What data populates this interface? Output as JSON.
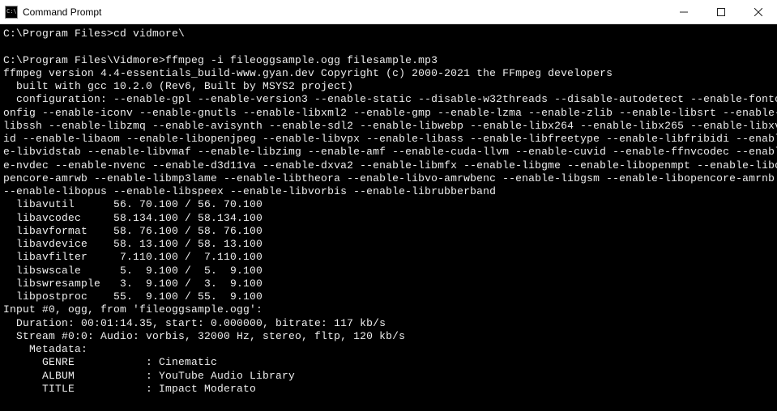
{
  "window": {
    "title": "Command Prompt"
  },
  "terminal": {
    "lines": [
      "C:\\Program Files>cd vidmore\\",
      "",
      "C:\\Program Files\\Vidmore>ffmpeg -i fileoggsample.ogg filesample.mp3",
      "ffmpeg version 4.4-essentials_build-www.gyan.dev Copyright (c) 2000-2021 the FFmpeg developers",
      "  built with gcc 10.2.0 (Rev6, Built by MSYS2 project)",
      "  configuration: --enable-gpl --enable-version3 --enable-static --disable-w32threads --disable-autodetect --enable-fontc",
      "onfig --enable-iconv --enable-gnutls --enable-libxml2 --enable-gmp --enable-lzma --enable-zlib --enable-libsrt --enable-",
      "libssh --enable-libzmq --enable-avisynth --enable-sdl2 --enable-libwebp --enable-libx264 --enable-libx265 --enable-libxv",
      "id --enable-libaom --enable-libopenjpeg --enable-libvpx --enable-libass --enable-libfreetype --enable-libfribidi --enabl",
      "e-libvidstab --enable-libvmaf --enable-libzimg --enable-amf --enable-cuda-llvm --enable-cuvid --enable-ffnvcodec --enabl",
      "e-nvdec --enable-nvenc --enable-d3d11va --enable-dxva2 --enable-libmfx --enable-libgme --enable-libopenmpt --enable-libo",
      "pencore-amrwb --enable-libmp3lame --enable-libtheora --enable-libvo-amrwbenc --enable-libgsm --enable-libopencore-amrnb ",
      "--enable-libopus --enable-libspeex --enable-libvorbis --enable-librubberband",
      "  libavutil      56. 70.100 / 56. 70.100",
      "  libavcodec     58.134.100 / 58.134.100",
      "  libavformat    58. 76.100 / 58. 76.100",
      "  libavdevice    58. 13.100 / 58. 13.100",
      "  libavfilter     7.110.100 /  7.110.100",
      "  libswscale      5.  9.100 /  5.  9.100",
      "  libswresample   3.  9.100 /  3.  9.100",
      "  libpostproc    55.  9.100 / 55.  9.100",
      "Input #0, ogg, from 'fileoggsample.ogg':",
      "  Duration: 00:01:14.35, start: 0.000000, bitrate: 117 kb/s",
      "  Stream #0:0: Audio: vorbis, 32000 Hz, stereo, fltp, 120 kb/s",
      "    Metadata:",
      "      GENRE           : Cinematic",
      "      ALBUM           : YouTube Audio Library",
      "      TITLE           : Impact Moderato"
    ]
  }
}
